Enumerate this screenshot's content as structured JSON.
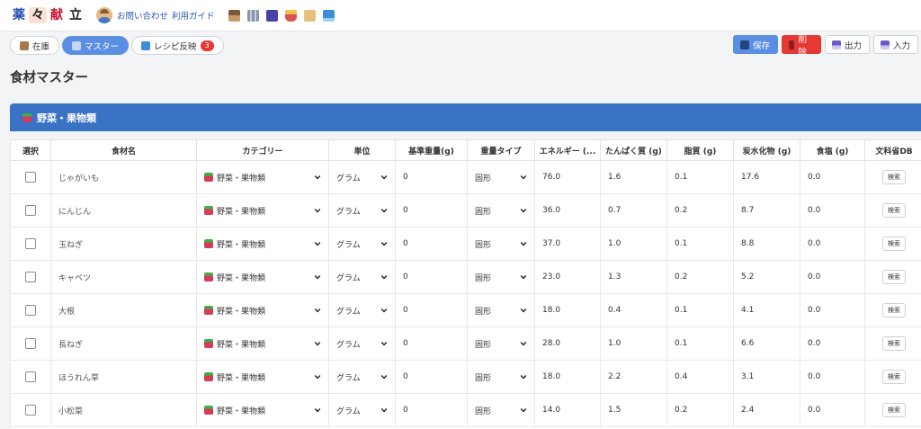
{
  "header": {
    "logo_chars": [
      "薬",
      "々",
      "献",
      "立"
    ],
    "links": [
      "お問い合わせ",
      "利用ガイド"
    ],
    "icons": [
      "box-icon",
      "building-icon",
      "book-icon",
      "flask-icon",
      "document-icon",
      "chart-icon"
    ]
  },
  "toolbar": {
    "tabs": [
      {
        "label": "在庫",
        "icon": "box-icon"
      },
      {
        "label": "マスター",
        "icon": "book-icon"
      },
      {
        "label": "レシピ反映",
        "icon": "refresh-icon",
        "badge": "3"
      }
    ],
    "actions": {
      "save": "保存",
      "delete": "削除",
      "export": "出力",
      "import": "入力"
    }
  },
  "page": {
    "title": "食材マスター",
    "section_title": "野菜・果物類"
  },
  "table": {
    "headers": [
      "選択",
      "食材名",
      "カテゴリー",
      "単位",
      "基準重量(g)",
      "重量タイプ",
      "エネルギー (...",
      "たんぱく質 (g)",
      "脂質 (g)",
      "炭水化物 (g)",
      "食塩 (g)",
      "文科省DB"
    ],
    "search_label": "検索",
    "rows": [
      {
        "name": "じゃがいも",
        "category": "野菜・果物類",
        "unit": "グラム",
        "base_weight": "0",
        "weight_type": "固形",
        "energy": "76.0",
        "protein": "1.6",
        "fat": "0.1",
        "carbs": "17.6",
        "salt": "0.0"
      },
      {
        "name": "にんじん",
        "category": "野菜・果物類",
        "unit": "グラム",
        "base_weight": "0",
        "weight_type": "固形",
        "energy": "36.0",
        "protein": "0.7",
        "fat": "0.2",
        "carbs": "8.7",
        "salt": "0.0"
      },
      {
        "name": "玉ねぎ",
        "category": "野菜・果物類",
        "unit": "グラム",
        "base_weight": "0",
        "weight_type": "固形",
        "energy": "37.0",
        "protein": "1.0",
        "fat": "0.1",
        "carbs": "8.8",
        "salt": "0.0"
      },
      {
        "name": "キャベツ",
        "category": "野菜・果物類",
        "unit": "グラム",
        "base_weight": "0",
        "weight_type": "固形",
        "energy": "23.0",
        "protein": "1.3",
        "fat": "0.2",
        "carbs": "5.2",
        "salt": "0.0"
      },
      {
        "name": "大根",
        "category": "野菜・果物類",
        "unit": "グラム",
        "base_weight": "0",
        "weight_type": "固形",
        "energy": "18.0",
        "protein": "0.4",
        "fat": "0.1",
        "carbs": "4.1",
        "salt": "0.0"
      },
      {
        "name": "長ねぎ",
        "category": "野菜・果物類",
        "unit": "グラム",
        "base_weight": "0",
        "weight_type": "固形",
        "energy": "28.0",
        "protein": "1.0",
        "fat": "0.1",
        "carbs": "6.6",
        "salt": "0.0"
      },
      {
        "name": "ほうれん草",
        "category": "野菜・果物類",
        "unit": "グラム",
        "base_weight": "0",
        "weight_type": "固形",
        "energy": "18.0",
        "protein": "2.2",
        "fat": "0.4",
        "carbs": "3.1",
        "salt": "0.0"
      },
      {
        "name": "小松菜",
        "category": "野菜・果物類",
        "unit": "グラム",
        "base_weight": "0",
        "weight_type": "固形",
        "energy": "14.0",
        "protein": "1.5",
        "fat": "0.2",
        "carbs": "2.4",
        "salt": "0.0"
      }
    ]
  },
  "colors": {
    "primary": "#5b8fe3",
    "section": "#3b73c4",
    "danger": "#e53935",
    "link": "#2a55b8"
  }
}
